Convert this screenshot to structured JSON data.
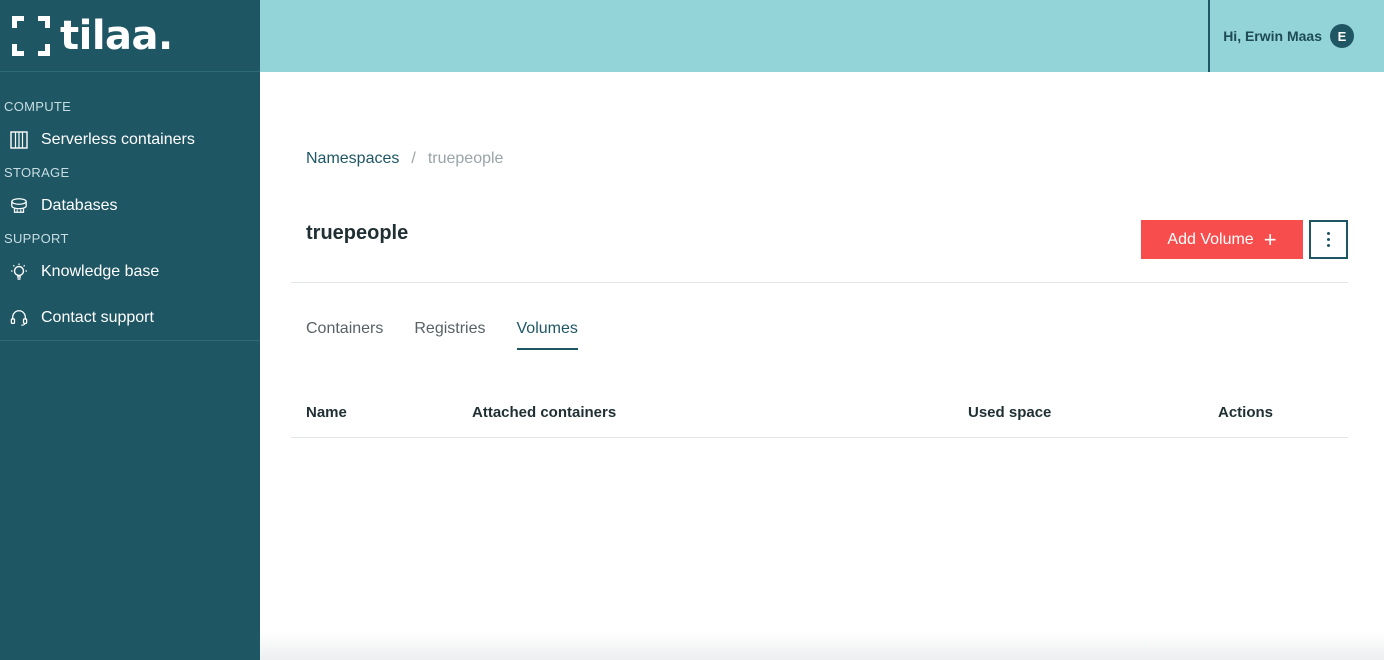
{
  "brand": {
    "name": "tilaa."
  },
  "sidebar": {
    "sections": [
      {
        "label": "COMPUTE",
        "items": [
          {
            "label": "Serverless containers",
            "icon": "container-grid-icon"
          }
        ]
      },
      {
        "label": "STORAGE",
        "items": [
          {
            "label": "Databases",
            "icon": "database-icon"
          }
        ]
      },
      {
        "label": "SUPPORT",
        "items": [
          {
            "label": "Knowledge base",
            "icon": "lightbulb-icon"
          },
          {
            "label": "Contact support",
            "icon": "headset-icon"
          }
        ]
      }
    ]
  },
  "topbar": {
    "greeting": "Hi, Erwin Maas",
    "avatar_initial": "E"
  },
  "breadcrumb": {
    "parent": "Namespaces",
    "separator": "/",
    "current": "truepeople"
  },
  "page": {
    "title": "truepeople",
    "add_button_label": "Add Volume",
    "add_button_icon": "+"
  },
  "tabs": [
    {
      "label": "Containers",
      "active": false
    },
    {
      "label": "Registries",
      "active": false
    },
    {
      "label": "Volumes",
      "active": true
    }
  ],
  "table": {
    "columns": [
      "Name",
      "Attached containers",
      "Used space",
      "Actions"
    ],
    "rows": []
  },
  "colors": {
    "sidebar": "#1e5664",
    "topbar": "#93d4d9",
    "accent_button": "#f74d4d"
  }
}
